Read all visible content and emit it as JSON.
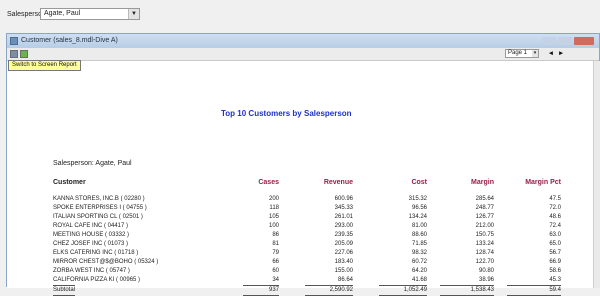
{
  "app": {
    "salesperson_label": "Salesperson",
    "salesperson_value": "Agate, Paul"
  },
  "window": {
    "title": "Customer (sales_8.mdl-Dive A)",
    "page_select": "Page 1",
    "tooltip": "Switch to Screen Report"
  },
  "report": {
    "title": "Top 10 Customers by Salesperson",
    "salesperson_line": "Salesperson: Agate, Paul",
    "headers": {
      "customer": "Customer",
      "cases": "Cases",
      "revenue": "Revenue",
      "cost": "Cost",
      "margin": "Margin",
      "margin_pct": "Margin Pct"
    },
    "rows": [
      {
        "customer": "KANNA STORES, INC.B ( 02280 )",
        "cases": "200",
        "revenue": "600.96",
        "cost": "315.32",
        "margin": "285.64",
        "pct": "47.5"
      },
      {
        "customer": "SPOKE ENTERPRISES I ( 04755 )",
        "cases": "118",
        "revenue": "345.33",
        "cost": "96.56",
        "margin": "248.77",
        "pct": "72.0"
      },
      {
        "customer": "ITALIAN SPORTING CL ( 02501 )",
        "cases": "105",
        "revenue": "261.01",
        "cost": "134.24",
        "margin": "126.77",
        "pct": "48.6"
      },
      {
        "customer": "ROYAL CAFE INC ( 04417 )",
        "cases": "100",
        "revenue": "293.00",
        "cost": "81.00",
        "margin": "212.00",
        "pct": "72.4"
      },
      {
        "customer": "MEETING HOUSE ( 03332 )",
        "cases": "86",
        "revenue": "239.35",
        "cost": "88.60",
        "margin": "150.75",
        "pct": "63.0"
      },
      {
        "customer": "CHEZ JOSEF INC ( 01073 )",
        "cases": "81",
        "revenue": "205.09",
        "cost": "71.85",
        "margin": "133.24",
        "pct": "65.0"
      },
      {
        "customer": "ELKS CATERING INC ( 01718 )",
        "cases": "79",
        "revenue": "227.06",
        "cost": "98.32",
        "margin": "128.74",
        "pct": "56.7"
      },
      {
        "customer": "MIRROR CHEST@$@BOHO ( 05324 )",
        "cases": "66",
        "revenue": "183.40",
        "cost": "60.72",
        "margin": "122.70",
        "pct": "66.9"
      },
      {
        "customer": "ZORBA WEST INC ( 05747 )",
        "cases": "60",
        "revenue": "155.00",
        "cost": "64.20",
        "margin": "90.80",
        "pct": "58.6"
      },
      {
        "customer": "CALIFORNIA PIZZA KI ( 00965 )",
        "cases": "34",
        "revenue": "86.64",
        "cost": "41.68",
        "margin": "38.96",
        "pct": "45.3"
      }
    ],
    "subtotal": {
      "customer": "Subtotal",
      "cases": "937",
      "revenue": "2,590.92",
      "cost": "1,052.49",
      "margin": "1,538.43",
      "pct": "59.4"
    }
  }
}
